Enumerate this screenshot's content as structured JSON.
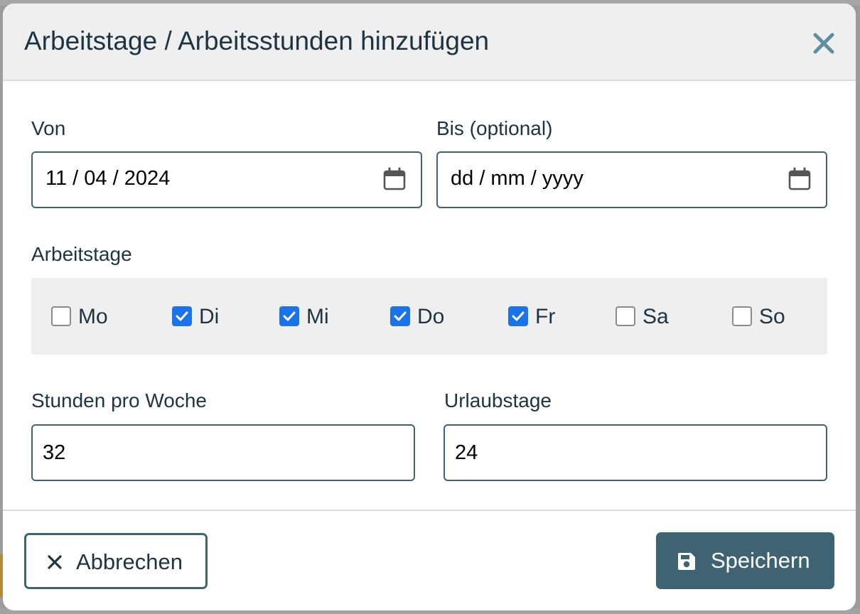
{
  "dialog": {
    "title": "Arbeitstage / Arbeitsstunden hinzufügen"
  },
  "fields": {
    "from": {
      "label": "Von",
      "value": "11 / 04 / 2024"
    },
    "to": {
      "label": "Bis (optional)",
      "placeholder": "dd / mm / yyyy"
    },
    "weekdays_label": "Arbeitstage",
    "weekdays": [
      {
        "label": "Mo",
        "checked": false
      },
      {
        "label": "Di",
        "checked": true
      },
      {
        "label": "Mi",
        "checked": true
      },
      {
        "label": "Do",
        "checked": true
      },
      {
        "label": "Fr",
        "checked": true
      },
      {
        "label": "Sa",
        "checked": false
      },
      {
        "label": "So",
        "checked": false
      }
    ],
    "hours_per_week": {
      "label": "Stunden pro Woche",
      "value": "32"
    },
    "vacation_days": {
      "label": "Urlaubstage",
      "value": "24"
    }
  },
  "buttons": {
    "cancel_label": "Abbrechen",
    "save_label": "Speichern"
  },
  "icons": {
    "close": "close-icon",
    "calendar": "calendar-icon",
    "cancel": "x-icon",
    "save": "floppy-disk-icon"
  },
  "colors": {
    "accent": "#3f6373",
    "checkbox_checked": "#1a73e8",
    "close_icon": "#5d8fa0",
    "header_bg": "#efefef"
  }
}
